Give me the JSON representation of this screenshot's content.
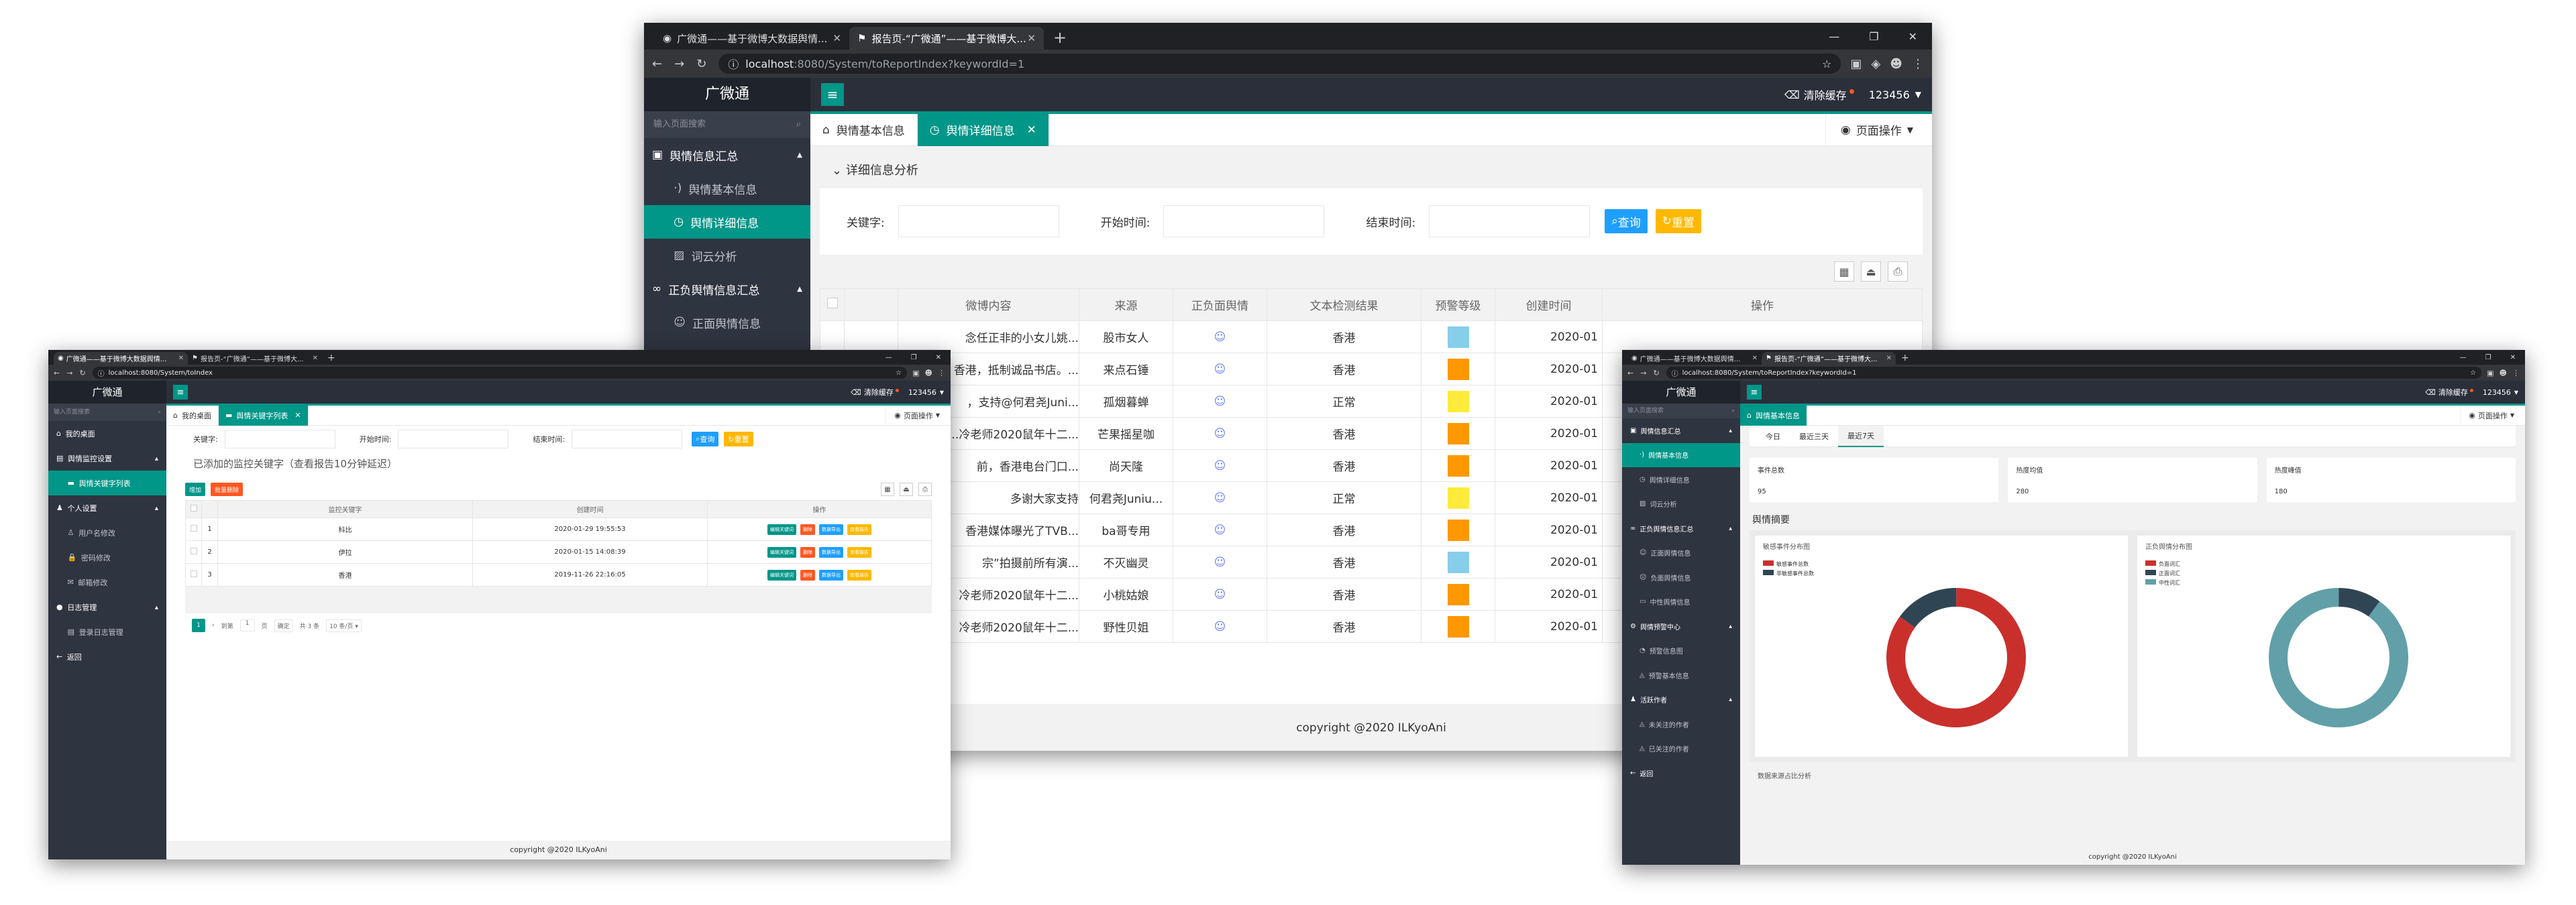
{
  "colors": {
    "teal": "#009688",
    "blue": "#1e9fff",
    "orange": "#ff9800",
    "yellow": "#ffeb3b",
    "lightblue": "#87ceeb",
    "red": "#ff5722",
    "donut_red": "#c9302c",
    "donut_dark": "#2f4554",
    "donut_teal": "#61a0a8"
  },
  "main": {
    "tabs": [
      "广微通——基于微博大数据舆情...",
      "报告页-“广微通”——基于微博大..."
    ],
    "new_tab": "+",
    "url_host": "localhost",
    "url_path": ":8080/System/toReportIndex?keywordId=1",
    "brand": "广微通",
    "sidebar_search": "输入页面搜索",
    "sidebar": [
      {
        "type": "grp",
        "label": "舆情信息汇总",
        "icon": "▣"
      },
      {
        "type": "sub",
        "label": "舆情基本信息",
        "icon": "·)"
      },
      {
        "type": "sub",
        "label": "舆情详细信息",
        "icon": "◷",
        "active": true
      },
      {
        "type": "sub",
        "label": "词云分析",
        "icon": "▨"
      },
      {
        "type": "grp",
        "label": "正负舆情信息汇总",
        "icon": "∞"
      },
      {
        "type": "sub",
        "label": "正面舆情信息",
        "icon": "☺"
      }
    ],
    "clear_cache": "清除缓存",
    "user": "123456",
    "page_tabs": [
      "舆情基本信息",
      "舆情详细信息"
    ],
    "page_op": "页面操作",
    "section_title": "详细信息分析",
    "filters": {
      "keyword": "关键字:",
      "start": "开始时间:",
      "end": "结束时间:",
      "search": "查询",
      "reset": "重置"
    },
    "columns": [
      "",
      "",
      "微博内容",
      "来源",
      "正负面舆情",
      "文本检测结果",
      "预警等级",
      "创建时间",
      "操作"
    ],
    "rows": [
      {
        "content": "念任正非的小女儿姚...",
        "source": "股市女人",
        "result": "香港",
        "level": "#87ceeb",
        "time": "2020-01"
      },
      {
        "content": "香港，抵制诚品书店。...",
        "source": "来点石锤",
        "result": "香港",
        "level": "#ff9800",
        "time": "2020-01"
      },
      {
        "content": "，支持@何君尧Juni...",
        "source": "孤烟暮蝉",
        "result": "正常",
        "level": "#ffeb3b",
        "time": "2020-01"
      },
      {
        "content": "…冷老师2020鼠年十二...",
        "source": "芒果摇星咖",
        "result": "香港",
        "level": "#ff9800",
        "time": "2020-01"
      },
      {
        "content": "前，香港电台门口...",
        "source": "尚天隆",
        "result": "香港",
        "level": "#ff9800",
        "time": "2020-01"
      },
      {
        "content": "多谢大家支持",
        "source": "何君尧Juniu...",
        "result": "正常",
        "level": "#ffeb3b",
        "time": "2020-01"
      },
      {
        "content": "香港媒体曝光了TVB...",
        "source": "ba哥专用",
        "result": "香港",
        "level": "#ff9800",
        "time": "2020-01"
      },
      {
        "content": "宗”拍摄前所有演...",
        "source": "不灭幽灵",
        "result": "香港",
        "level": "#87ceeb",
        "time": "2020-01"
      },
      {
        "content": "冷老师2020鼠年十二...",
        "source": "小桃姑娘",
        "result": "香港",
        "level": "#ff9800",
        "time": "2020-01"
      },
      {
        "content": "冷老师2020鼠年十二...",
        "source": "野性贝姐",
        "result": "香港",
        "level": "#ff9800",
        "time": "2020-01"
      }
    ],
    "footer": "copyright @2020 ILKyoAni"
  },
  "left": {
    "tabs": [
      "广微通——基于微博大数据舆情...",
      "报告页-“广微通”——基于微博大..."
    ],
    "url": "localhost:8080/System/toIndex",
    "brand": "广微通",
    "sidebar_search": "输入页面搜索",
    "sidebar": [
      {
        "type": "grp",
        "label": "我的桌面",
        "icon": "⌂"
      },
      {
        "type": "grp",
        "label": "舆情监控设置",
        "icon": "▤",
        "arrow": true
      },
      {
        "type": "sub",
        "label": "舆情关键字列表",
        "icon": "▬",
        "active": true
      },
      {
        "type": "grp",
        "label": "个人设置",
        "icon": "♟",
        "arrow": true
      },
      {
        "type": "sub",
        "label": "用户名修改",
        "icon": "♙"
      },
      {
        "type": "sub",
        "label": "密码修改",
        "icon": "🔒"
      },
      {
        "type": "sub",
        "label": "邮箱修改",
        "icon": "✉"
      },
      {
        "type": "grp",
        "label": "日志管理",
        "icon": "●",
        "arrow": true
      },
      {
        "type": "sub",
        "label": "登录日志管理",
        "icon": "▤"
      },
      {
        "type": "grp",
        "label": "返回",
        "icon": "←"
      }
    ],
    "clear_cache": "清除缓存",
    "user": "123456",
    "page_tabs": [
      "我的桌面",
      "舆情关键字列表"
    ],
    "page_op": "页面操作",
    "filters": {
      "keyword": "关键字:",
      "start": "开始时间:",
      "end": "结束时间:",
      "search": "查询",
      "reset": "重置"
    },
    "heading": "已添加的监控关键字（查看报告10分钟延迟）",
    "add": "增加",
    "batch_delete": "批量删除",
    "columns": [
      "",
      "",
      "监控关键字",
      "创建时间",
      "操作"
    ],
    "rows": [
      {
        "n": "1",
        "kw": "科比",
        "time": "2020-01-29 19:55:53"
      },
      {
        "n": "2",
        "kw": "伊拉",
        "time": "2020-01-15 14:08:39"
      },
      {
        "n": "3",
        "kw": "香港",
        "time": "2019-11-26 22:16:05"
      }
    ],
    "ops": [
      "编辑关键词",
      "删除",
      "数据导出",
      "查看报告"
    ],
    "pager": {
      "page": "1",
      "goto": "到第",
      "page_word": "页",
      "confirm": "确定",
      "total": "共 3 条",
      "size": "10 条/页"
    },
    "footer": "copyright @2020 ILKyoAni"
  },
  "right": {
    "tabs": [
      "广微通——基于微博大数据舆情...",
      "报告页-“广微通”——基于微博大..."
    ],
    "url": "localhost:8080/System/toReportIndex?keywordId=1",
    "brand": "广微通",
    "sidebar_search": "输入页面搜索",
    "sidebar": [
      {
        "type": "grp",
        "label": "舆情信息汇总",
        "icon": "▣",
        "arrow": true
      },
      {
        "type": "sub",
        "label": "舆情基本信息",
        "icon": "·)",
        "active": true
      },
      {
        "type": "sub",
        "label": "舆情详细信息",
        "icon": "◷"
      },
      {
        "type": "sub",
        "label": "词云分析",
        "icon": "▨"
      },
      {
        "type": "grp",
        "label": "正负舆情信息汇总",
        "icon": "∞",
        "arrow": true
      },
      {
        "type": "sub",
        "label": "正面舆情信息",
        "icon": "☺"
      },
      {
        "type": "sub",
        "label": "负面舆情信息",
        "icon": "☹"
      },
      {
        "type": "sub",
        "label": "中性舆情信息",
        "icon": "▭"
      },
      {
        "type": "grp",
        "label": "舆情预警中心",
        "icon": "⚙",
        "arrow": true
      },
      {
        "type": "sub",
        "label": "预警信息图",
        "icon": "◔"
      },
      {
        "type": "sub",
        "label": "预警基本信息",
        "icon": "◬"
      },
      {
        "type": "grp",
        "label": "活跃作者",
        "icon": "♟",
        "arrow": true
      },
      {
        "type": "sub",
        "label": "未关注的作者",
        "icon": "◬"
      },
      {
        "type": "sub",
        "label": "已关注的作者",
        "icon": "◬"
      },
      {
        "type": "grp",
        "label": "返回",
        "icon": "←"
      }
    ],
    "clear_cache": "清除缓存",
    "user": "123456",
    "page_tab": "舆情基本信息",
    "page_op": "页面操作",
    "range_tabs": [
      "今日",
      "最近三天",
      "最近7天"
    ],
    "stats": [
      {
        "label": "事件总数",
        "value": "95"
      },
      {
        "label": "热度均值",
        "value": "280"
      },
      {
        "label": "热度峰值",
        "value": "180"
      }
    ],
    "digest": "舆情摘要",
    "chart1": {
      "title": "敏感事件分布图",
      "legend": [
        "敏感事件总数",
        "非敏感事件总数"
      ]
    },
    "chart2": {
      "title": "正负舆情分布图",
      "legend": [
        "负面词汇",
        "正面词汇",
        "中性词汇"
      ]
    },
    "bottom_label": "数据来源占比分析",
    "footer": "copyright @2020 ILKyoAni"
  },
  "chart_data": [
    {
      "type": "pie",
      "title": "敏感事件分布图",
      "series": [
        {
          "name": "敏感事件总数",
          "values": [
            85
          ]
        },
        {
          "name": "非敏感事件总数",
          "values": [
            15
          ]
        }
      ]
    },
    {
      "type": "pie",
      "title": "正负舆情分布图",
      "series": [
        {
          "name": "负面词汇",
          "values": [
            0
          ]
        },
        {
          "name": "正面词汇",
          "values": [
            10
          ]
        },
        {
          "name": "中性词汇",
          "values": [
            90
          ]
        }
      ]
    }
  ]
}
